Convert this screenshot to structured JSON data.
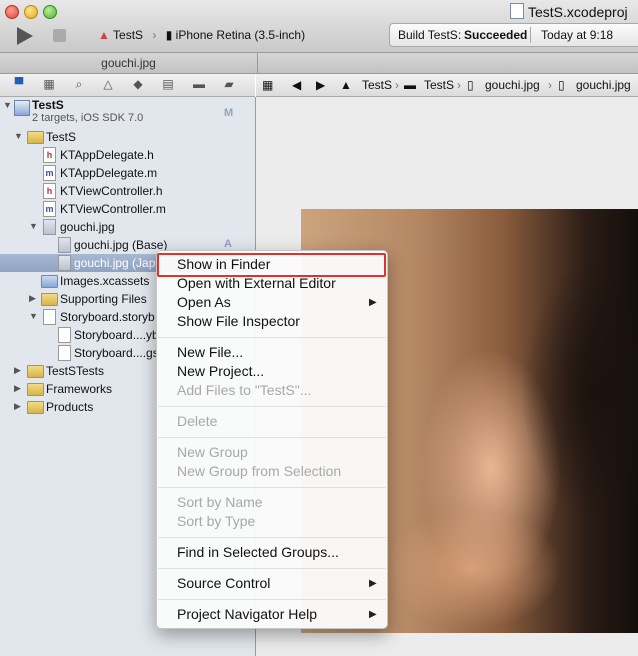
{
  "window": {
    "title": "TestS.xcodeproj"
  },
  "toolbar": {
    "run_icon": "play-icon",
    "stop_icon": "stop-icon",
    "scheme": "TestS",
    "destination": "iPhone Retina (3.5-inch)",
    "status_prefix": "Build TestS:",
    "status_result": "Succeeded",
    "status_time": "Today at 9:18"
  },
  "tab": {
    "label": "gouchi.jpg"
  },
  "navigator_icons": [
    "folder-icon",
    "symbol-icon",
    "search-icon",
    "warning-icon",
    "test-icon",
    "breakpoint-icon",
    "debug-icon",
    "log-icon"
  ],
  "tree": [
    {
      "label": "TestS",
      "kind": "project",
      "subtitle": "2 targets, iOS SDK 7.0",
      "badge": "M"
    },
    {
      "label": "TestS",
      "kind": "folder"
    },
    {
      "label": "KTAppDelegate.h",
      "kind": "h"
    },
    {
      "label": "KTAppDelegate.m",
      "kind": "m"
    },
    {
      "label": "KTViewController.h",
      "kind": "h"
    },
    {
      "label": "KTViewController.m",
      "kind": "m"
    },
    {
      "label": "gouchi.jpg",
      "kind": "group"
    },
    {
      "label": "gouchi.jpg (Base)",
      "kind": "img",
      "badge": "A"
    },
    {
      "label": "gouchi.jpg (Jap",
      "kind": "img"
    },
    {
      "label": "Images.xcassets",
      "kind": "assets"
    },
    {
      "label": "Supporting Files",
      "kind": "folder"
    },
    {
      "label": "Storyboard.storyb",
      "kind": "group"
    },
    {
      "label": "Storyboard....yb",
      "kind": "file"
    },
    {
      "label": "Storyboard....gs",
      "kind": "file"
    },
    {
      "label": "TestSTests",
      "kind": "folder"
    },
    {
      "label": "Frameworks",
      "kind": "folder"
    },
    {
      "label": "Products",
      "kind": "folder"
    }
  ],
  "jumpbar": {
    "items": [
      "TestS",
      "TestS",
      "gouchi.jpg",
      "gouchi.jpg"
    ]
  },
  "context_menu": {
    "items": [
      {
        "label": "Show in Finder",
        "enabled": true
      },
      {
        "label": "Open with External Editor",
        "enabled": true
      },
      {
        "label": "Open As",
        "enabled": true,
        "submenu": true
      },
      {
        "label": "Show File Inspector",
        "enabled": true
      },
      {
        "label": "New File...",
        "enabled": true
      },
      {
        "label": "New Project...",
        "enabled": true
      },
      {
        "label": "Add Files to \"TestS\"...",
        "enabled": false
      },
      {
        "label": "Delete",
        "enabled": false
      },
      {
        "label": "New Group",
        "enabled": false
      },
      {
        "label": "New Group from Selection",
        "enabled": false
      },
      {
        "label": "Sort by Name",
        "enabled": false
      },
      {
        "label": "Sort by Type",
        "enabled": false
      },
      {
        "label": "Find in Selected Groups...",
        "enabled": true
      },
      {
        "label": "Source Control",
        "enabled": true,
        "submenu": true
      },
      {
        "label": "Project Navigator Help",
        "enabled": true,
        "submenu": true
      }
    ]
  },
  "colors": {
    "highlight_box": "#e0312b",
    "selection": "#8fa3c3",
    "sidebar": "#e2e7ed"
  }
}
